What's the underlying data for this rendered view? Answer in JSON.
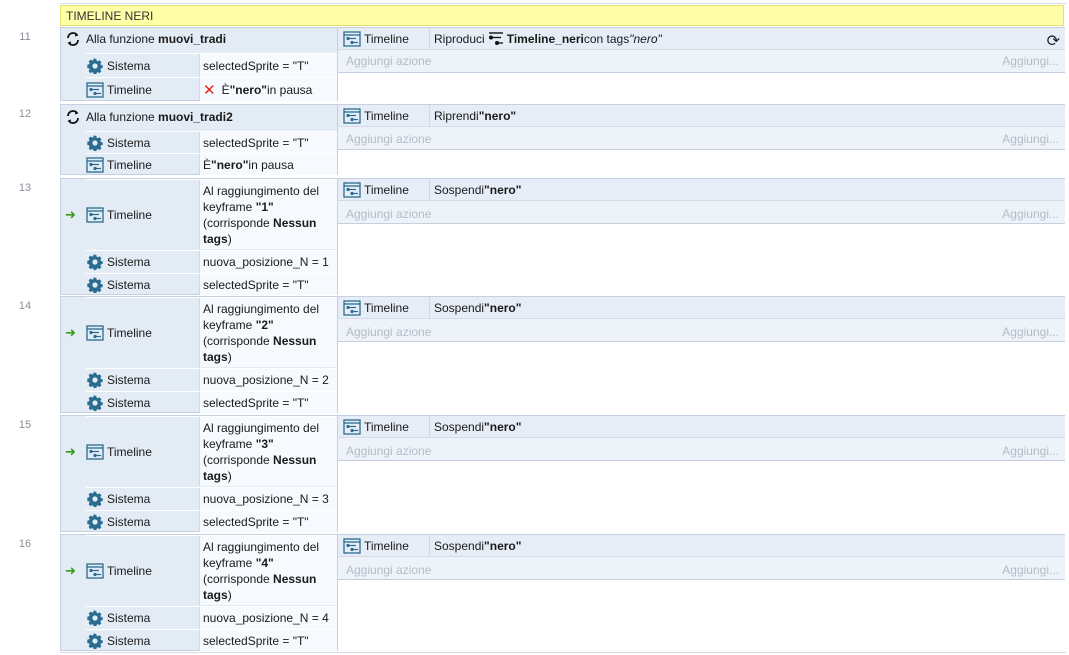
{
  "comment": "TIMELINE NERI",
  "labels": {
    "add_action": "Aggiungi azione",
    "add_other": "Aggiungi..."
  },
  "icons": {
    "sistema": "gear-icon",
    "timeline": "timeline-icon",
    "repeat": "repeat-icon",
    "trigger": "trigger-arrow-icon"
  },
  "colors": {
    "comment_bg": "#ffffa8",
    "condition_bg": "#e3ebf5",
    "action_bg": "#eef3f9",
    "icon_blue": "#2a6c8f"
  },
  "events": [
    {
      "number": "11",
      "header_prefix": "Alla funzione ",
      "header_name": "muovi_tradi",
      "conditions": [
        {
          "object": "Sistema",
          "text": "selectedSprite = \"T\""
        },
        {
          "object": "Timeline",
          "text_a": "È ",
          "text_b": "\"nero\"",
          "text_c": " in pausa"
        }
      ],
      "action": {
        "object": "Timeline",
        "text_a": "Riproduci ",
        "text_b": "Timeline_neri",
        "text_c": " con tags ",
        "text_d": "\"nero\""
      }
    },
    {
      "number": "12",
      "header_prefix": "Alla funzione ",
      "header_name": "muovi_tradi2",
      "conditions": [
        {
          "object": "Sistema",
          "text": "selectedSprite = \"T\""
        },
        {
          "object": "Timeline",
          "text_a": "È ",
          "text_b": "\"nero\"",
          "text_c": " in pausa"
        }
      ],
      "action": {
        "object": "Timeline",
        "text_a": "Riprendi ",
        "text_b": "\"nero\""
      }
    },
    {
      "number": "13",
      "trigger": {
        "object": "Timeline",
        "line1": "Al raggiungimento del",
        "line2a": "keyframe ",
        "line2b": "\"1\"",
        "line3a": "(corrisponde ",
        "line3b": "Nessun",
        "line4a": "tags",
        "line4b": ")"
      },
      "conditions": [
        {
          "object": "Sistema",
          "text": "nuova_posizione_N = 1"
        },
        {
          "object": "Sistema",
          "text": "selectedSprite = \"T\""
        }
      ],
      "action": {
        "object": "Timeline",
        "text_a": "Sospendi ",
        "text_b": "\"nero\""
      }
    },
    {
      "number": "14",
      "trigger": {
        "object": "Timeline",
        "line1": "Al raggiungimento del",
        "line2a": "keyframe ",
        "line2b": "\"2\"",
        "line3a": "(corrisponde ",
        "line3b": "Nessun",
        "line4a": "tags",
        "line4b": ")"
      },
      "conditions": [
        {
          "object": "Sistema",
          "text": "nuova_posizione_N = 2"
        },
        {
          "object": "Sistema",
          "text": "selectedSprite = \"T\""
        }
      ],
      "action": {
        "object": "Timeline",
        "text_a": "Sospendi ",
        "text_b": "\"nero\""
      }
    },
    {
      "number": "15",
      "trigger": {
        "object": "Timeline",
        "line1": "Al raggiungimento del",
        "line2a": "keyframe ",
        "line2b": "\"3\"",
        "line3a": "(corrisponde ",
        "line3b": "Nessun",
        "line4a": "tags",
        "line4b": ")"
      },
      "conditions": [
        {
          "object": "Sistema",
          "text": "nuova_posizione_N = 3"
        },
        {
          "object": "Sistema",
          "text": "selectedSprite = \"T\""
        }
      ],
      "action": {
        "object": "Timeline",
        "text_a": "Sospendi ",
        "text_b": "\"nero\""
      }
    },
    {
      "number": "16",
      "trigger": {
        "object": "Timeline",
        "line1": "Al raggiungimento del",
        "line2a": "keyframe ",
        "line2b": "\"4\"",
        "line3a": "(corrisponde ",
        "line3b": "Nessun",
        "line4a": "tags",
        "line4b": ")"
      },
      "conditions": [
        {
          "object": "Sistema",
          "text": "nuova_posizione_N = 4"
        },
        {
          "object": "Sistema",
          "text": "selectedSprite = \"T\""
        }
      ],
      "action": {
        "object": "Timeline",
        "text_a": "Sospendi ",
        "text_b": "\"nero\""
      }
    }
  ]
}
